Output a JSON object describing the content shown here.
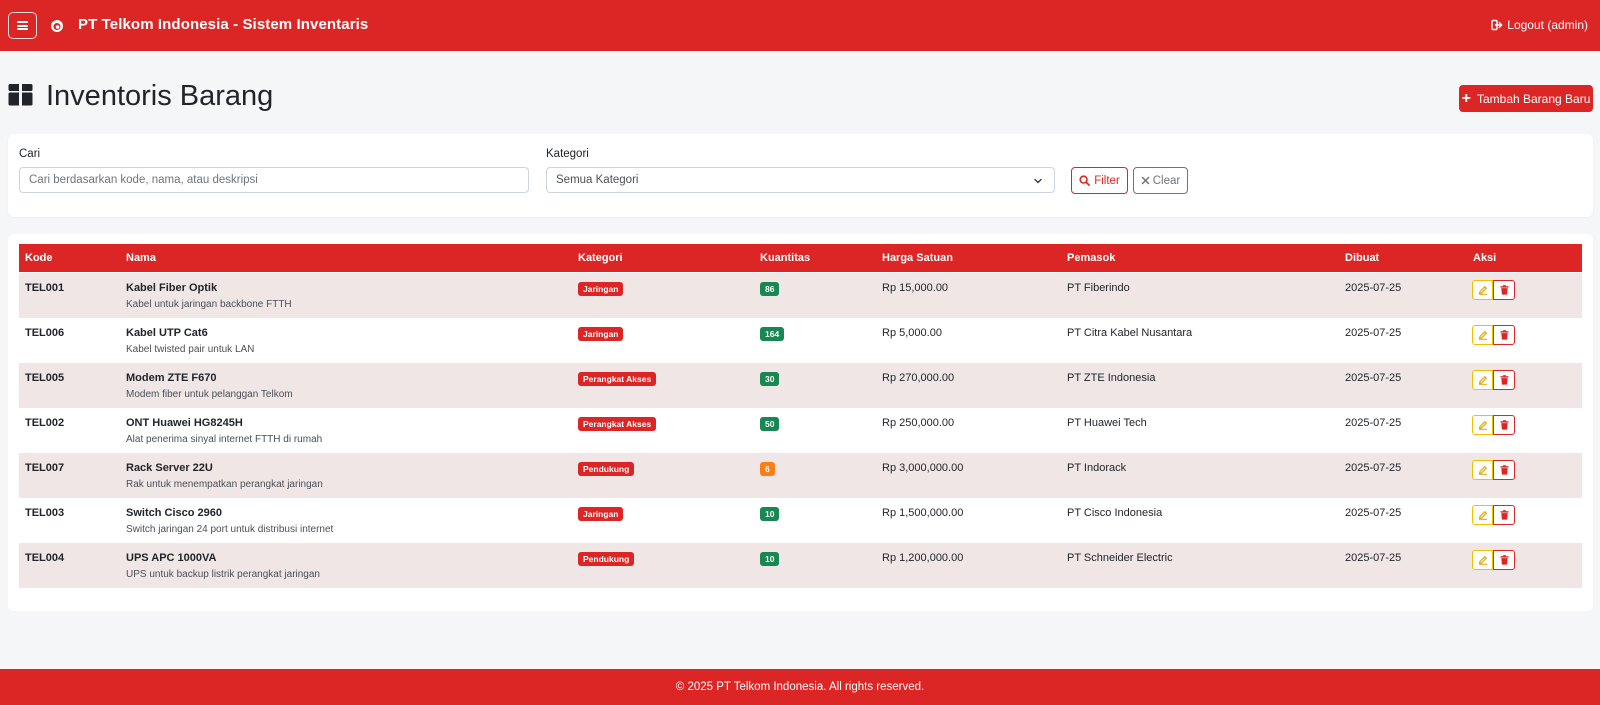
{
  "navbar": {
    "brand": "PT Telkom Indonesia - Sistem Inventaris",
    "logout": "Logout (admin)"
  },
  "page": {
    "title": "Inventoris Barang",
    "add_button": "Tambah Barang Baru"
  },
  "filter": {
    "search_label": "Cari",
    "search_placeholder": "Cari berdasarkan kode, nama, atau deskripsi",
    "category_label": "Kategori",
    "category_value": "Semua Kategori",
    "filter_button": "Filter",
    "clear_button": "Clear"
  },
  "table": {
    "headers": [
      "Kode",
      "Nama",
      "Kategori",
      "Kuantitas",
      "Harga Satuan",
      "Pemasok",
      "Dibuat",
      "Aksi"
    ],
    "rows": [
      {
        "code": "TEL001",
        "name": "Kabel Fiber Optik",
        "desc": "Kabel untuk jaringan backbone FTTH",
        "category": "Jaringan",
        "qty": "86",
        "qty_color": "#198754",
        "price": "Rp 15,000.00",
        "supplier": "PT Fiberindo",
        "date": "2025-07-25"
      },
      {
        "code": "TEL006",
        "name": "Kabel UTP Cat6",
        "desc": "Kabel twisted pair untuk LAN",
        "category": "Jaringan",
        "qty": "164",
        "qty_color": "#198754",
        "price": "Rp 5,000.00",
        "supplier": "PT Citra Kabel Nusantara",
        "date": "2025-07-25"
      },
      {
        "code": "TEL005",
        "name": "Modem ZTE F670",
        "desc": "Modem fiber untuk pelanggan Telkom",
        "category": "Perangkat Akses",
        "qty": "30",
        "qty_color": "#198754",
        "price": "Rp 270,000.00",
        "supplier": "PT ZTE Indonesia",
        "date": "2025-07-25"
      },
      {
        "code": "TEL002",
        "name": "ONT Huawei HG8245H",
        "desc": "Alat penerima sinyal internet FTTH di rumah",
        "category": "Perangkat Akses",
        "qty": "50",
        "qty_color": "#198754",
        "price": "Rp 250,000.00",
        "supplier": "PT Huawei Tech",
        "date": "2025-07-25"
      },
      {
        "code": "TEL007",
        "name": "Rack Server 22U",
        "desc": "Rak untuk menempatkan perangkat jaringan",
        "category": "Pendukung",
        "qty": "6",
        "qty_color": "#fd7e14",
        "price": "Rp 3,000,000.00",
        "supplier": "PT Indorack",
        "date": "2025-07-25"
      },
      {
        "code": "TEL003",
        "name": "Switch Cisco 2960",
        "desc": "Switch jaringan 24 port untuk distribusi internet",
        "category": "Jaringan",
        "qty": "10",
        "qty_color": "#198754",
        "price": "Rp 1,500,000.00",
        "supplier": "PT Cisco Indonesia",
        "date": "2025-07-25"
      },
      {
        "code": "TEL004",
        "name": "UPS APC 1000VA",
        "desc": "UPS untuk backup listrik perangkat jaringan",
        "category": "Pendukung",
        "qty": "10",
        "qty_color": "#198754",
        "price": "Rp 1,200,000.00",
        "supplier": "PT Schneider Electric",
        "date": "2025-07-25"
      }
    ]
  },
  "footer": {
    "text": "© 2025 PT Telkom Indonesia. All rights reserved."
  },
  "colors": {
    "primary": "#dc2626",
    "success": "#198754",
    "warning": "#fd7e14",
    "row_stripe": "#f0e6e6"
  },
  "icons": {
    "menu": "hamburger-icon",
    "brand": "telkom-logo-icon",
    "logout": "sign-out-icon",
    "title": "box-icon",
    "add": "plus-icon",
    "filter": "search-icon",
    "clear": "x-icon",
    "edit": "edit-icon",
    "delete": "trash-icon"
  }
}
